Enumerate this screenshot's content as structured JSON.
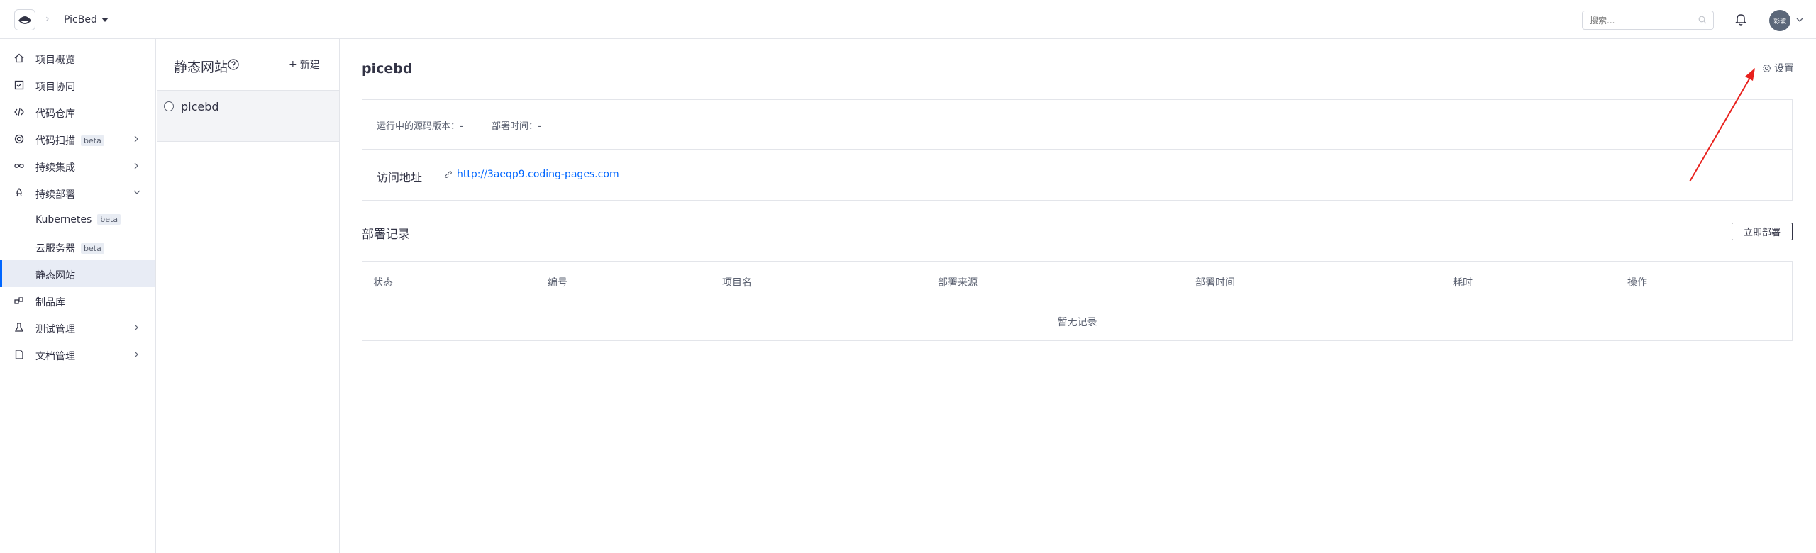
{
  "topbar": {
    "project_name": "PicBed",
    "search_placeholder": "搜索...",
    "avatar_text": "彩玻"
  },
  "sidebar": {
    "items": [
      {
        "label": "项目概览",
        "icon": "home-icon"
      },
      {
        "label": "项目协同",
        "icon": "checkbox-icon"
      },
      {
        "label": "代码仓库",
        "icon": "code-icon"
      },
      {
        "label": "代码扫描",
        "icon": "scan-icon",
        "badge": "beta"
      },
      {
        "label": "持续集成",
        "icon": "infinity-icon"
      },
      {
        "label": "持续部署",
        "icon": "rocket-icon"
      },
      {
        "label": "Kubernetes",
        "badge": "beta"
      },
      {
        "label": "云服务器",
        "badge": "beta"
      },
      {
        "label": "静态网站"
      },
      {
        "label": "制品库",
        "icon": "package-icon"
      },
      {
        "label": "测试管理",
        "icon": "flask-icon"
      },
      {
        "label": "文档管理",
        "icon": "document-icon"
      }
    ]
  },
  "midcol": {
    "title": "静态网站",
    "new_label": "新建",
    "sites": [
      {
        "name": "picebd"
      }
    ]
  },
  "main": {
    "title": "picebd",
    "settings_label": "设置",
    "source_version": "运行中的源码版本：-",
    "deploy_time": "部署时间：-",
    "access_label": "访问地址",
    "access_url": "http://3aeqp9.coding-pages.com",
    "records_title": "部署记录",
    "deploy_now": "立即部署",
    "columns": [
      "状态",
      "编号",
      "项目名",
      "部署来源",
      "部署时间",
      "耗时",
      "操作"
    ],
    "empty_text": "暂无记录"
  },
  "colors": {
    "accent": "#0066ff",
    "annotation_arrow": "#e8201c"
  }
}
